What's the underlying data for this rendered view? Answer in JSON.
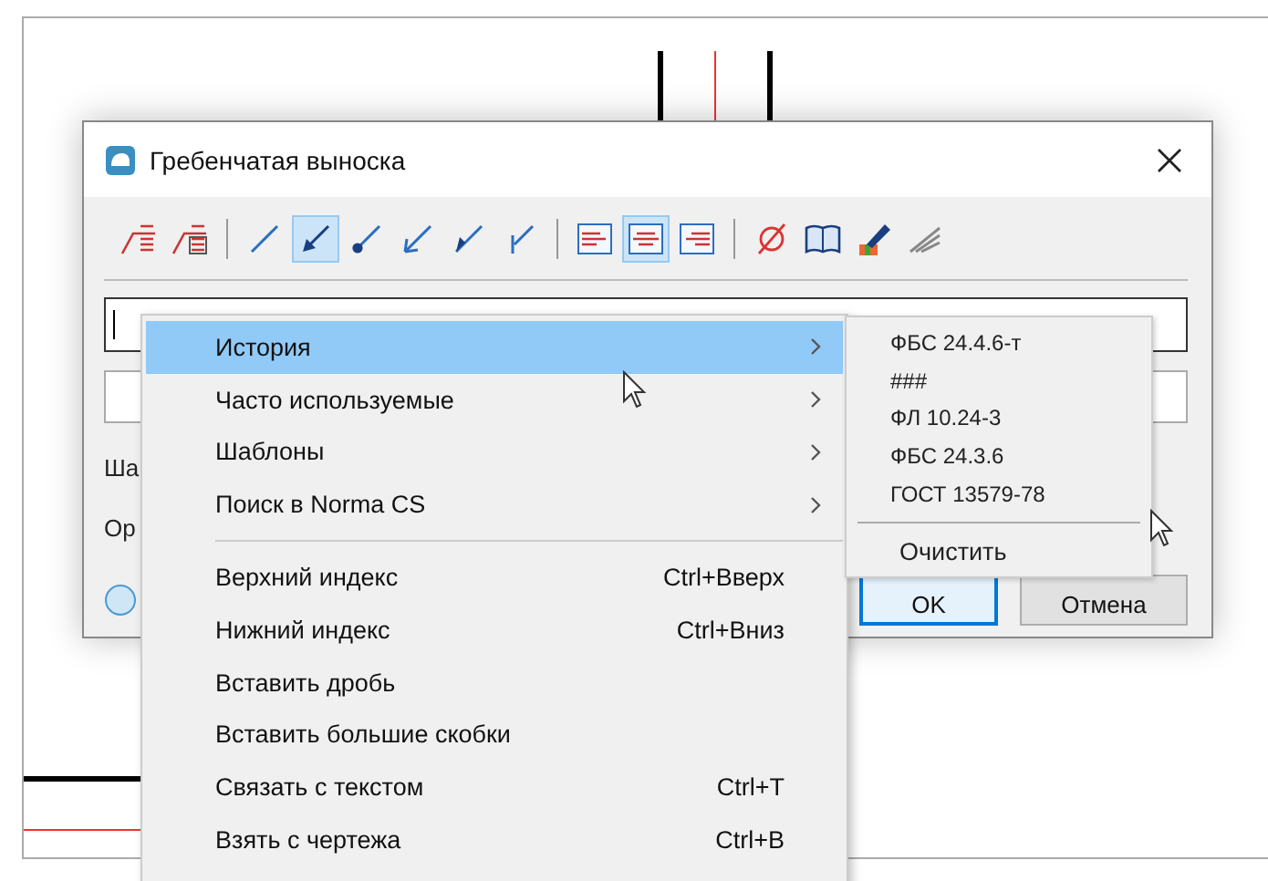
{
  "dialog": {
    "title": "Гребенчатая выноска",
    "toolbar": [
      [
        {
          "kind": "leader-table",
          "selected": false
        },
        {
          "kind": "leader-table-box",
          "selected": false
        }
      ],
      [
        {
          "kind": "line",
          "selected": false
        },
        {
          "kind": "arrow-filled",
          "selected": true
        },
        {
          "kind": "dot",
          "selected": false
        },
        {
          "kind": "arrow-open",
          "selected": false
        },
        {
          "kind": "arrow-half",
          "selected": false
        },
        {
          "kind": "tick",
          "selected": false
        }
      ],
      [
        {
          "kind": "align-left",
          "selected": false
        },
        {
          "kind": "align-center",
          "selected": true
        },
        {
          "kind": "align-right",
          "selected": false
        }
      ],
      [
        {
          "kind": "diameter",
          "selected": false
        },
        {
          "kind": "book",
          "selected": false
        },
        {
          "kind": "brush",
          "selected": false
        },
        {
          "kind": "wires",
          "selected": false
        }
      ]
    ],
    "labels": [
      "Ша",
      "Ор"
    ],
    "buttons": [
      {
        "label": "OK",
        "default": true
      },
      {
        "label": "Отмена",
        "default": false
      }
    ]
  },
  "context_menu": [
    {
      "kind": "item",
      "label": "История",
      "submenu": true,
      "selected": true
    },
    {
      "kind": "item",
      "label": "Часто используемые",
      "submenu": true,
      "selected": false
    },
    {
      "kind": "item",
      "label": "Шаблоны",
      "submenu": true,
      "selected": false
    },
    {
      "kind": "item",
      "label": "Поиск в Norma CS",
      "submenu": true,
      "selected": false
    },
    {
      "kind": "separator"
    },
    {
      "kind": "item",
      "label": "Верхний индекс",
      "shortcut": "Ctrl+Вверх",
      "submenu": false,
      "selected": false
    },
    {
      "kind": "item",
      "label": "Нижний индекс",
      "shortcut": "Ctrl+Вниз",
      "submenu": false,
      "selected": false
    },
    {
      "kind": "item",
      "label": "Вставить дробь",
      "submenu": false,
      "selected": false
    },
    {
      "kind": "item",
      "label": "Вставить большие скобки",
      "submenu": false,
      "selected": false
    },
    {
      "kind": "item",
      "label": "Связать с текстом",
      "shortcut": "Ctrl+T",
      "submenu": false,
      "selected": false
    },
    {
      "kind": "item",
      "label": "Взять с чертежа",
      "shortcut": "Ctrl+B",
      "submenu": false,
      "selected": false
    }
  ],
  "submenu": [
    {
      "kind": "item",
      "label": "ФБС 24.4.6-т"
    },
    {
      "kind": "item",
      "label": "###"
    },
    {
      "kind": "item",
      "label": "ФЛ 10.24-3"
    },
    {
      "kind": "item",
      "label": "ФБС 24.3.6"
    },
    {
      "kind": "item",
      "label": "ГОСТ 13579-78"
    },
    {
      "kind": "separator"
    },
    {
      "kind": "action",
      "label": "Очистить"
    }
  ]
}
